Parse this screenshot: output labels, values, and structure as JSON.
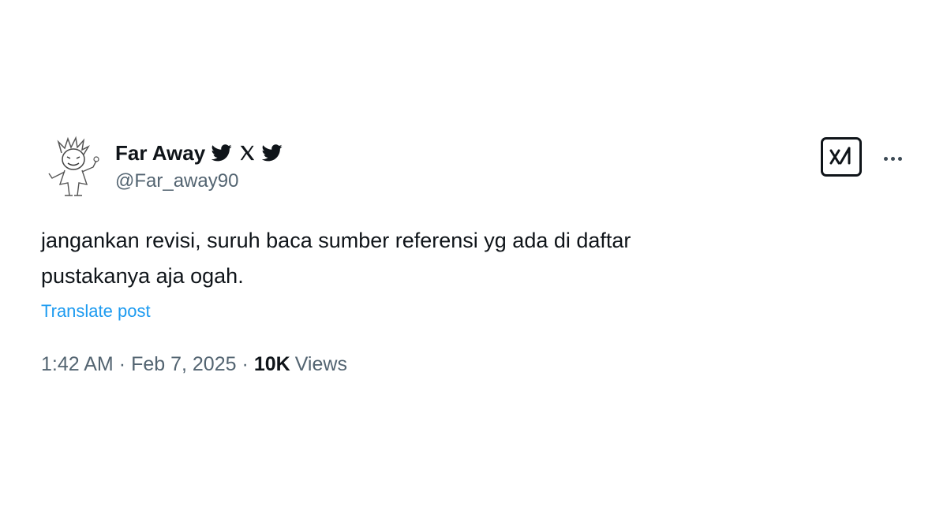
{
  "tweet": {
    "author": {
      "display_name": "Far Away",
      "handle": "@Far_away90",
      "badges": [
        "twitter-bird-icon",
        "x-logo-icon",
        "twitter-bird-icon"
      ],
      "avatar": "sketch-character-avatar"
    },
    "text": "jangankan revisi, suruh baca sumber referensi yg ada di daftar\npustakanya aja ogah.",
    "translate_label": "Translate post",
    "time": "1:42 AM",
    "separator": "·",
    "date": "Feb 7, 2025",
    "views_count": "10K",
    "views_label": "Views",
    "header_actions": {
      "grok_icon": "grok-icon",
      "more_icon": "more-options-icon"
    }
  },
  "colors": {
    "text_primary": "#0f1419",
    "text_secondary": "#536471",
    "link_blue": "#1d9bf0"
  }
}
